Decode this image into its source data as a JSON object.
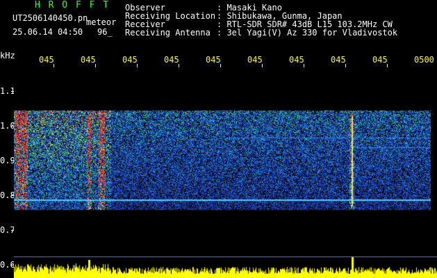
{
  "header": {
    "logo": "H R O F F T",
    "filename": "UT2506140450.pn",
    "meteor_label": "meteor",
    "datetime": "25.06.14 04:50",
    "count": "96_"
  },
  "info": {
    "labels": [
      "Observer",
      "Receiving Location",
      "Receiver",
      "Receiving Antenna"
    ],
    "values": [
      ": Masaki Kano",
      ": Shibukawa, Gunma, Japan",
      ": RTL-SDR SDR# 43dB L15 103.2MHz CW",
      ": 3el Yagi(V) Az 330 for Vladivostok"
    ]
  },
  "axes": {
    "y_unit": "kHz",
    "y_ticks": [
      "1.1",
      "1.0",
      "0.9",
      "0.8",
      "0.7",
      "0.6"
    ],
    "x_ticks": [
      "045",
      "045",
      "045",
      "045",
      "045",
      "045",
      "045",
      "045",
      "045",
      "0500"
    ]
  },
  "colors": {
    "background": "#000000",
    "logo": "#33ff33",
    "time_ticks": "#ffff00",
    "amplitude": "#ffff00",
    "baseline": "#4060ff"
  }
}
